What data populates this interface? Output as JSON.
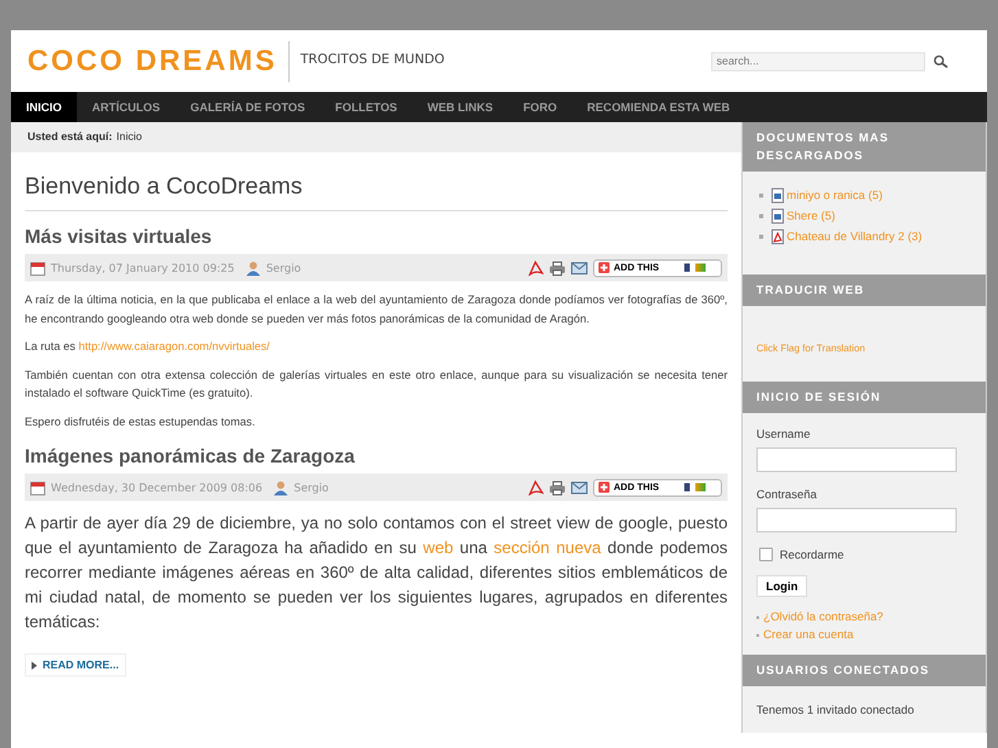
{
  "header": {
    "logo": "COCO DREAMS",
    "tagline": "TROCITOS DE MUNDO",
    "search": {
      "placeholder": "search..."
    }
  },
  "nav": [
    {
      "label": "INICIO",
      "selected": true
    },
    {
      "label": "ARTÍCULOS",
      "selected": false
    },
    {
      "label": "GALERÍA DE FOTOS",
      "selected": false
    },
    {
      "label": "FOLLETOS",
      "selected": false
    },
    {
      "label": "WEB LINKS",
      "selected": false
    },
    {
      "label": "FORO",
      "selected": false
    },
    {
      "label": "RECOMIENDA ESTA WEB",
      "selected": false
    }
  ],
  "breadcrumb": {
    "label": "Usted está aquí:",
    "current": "Inicio"
  },
  "page_title": "Bienvenido a CocoDreams",
  "articles": [
    {
      "title": "Más visitas virtuales",
      "date": "Thursday, 07 January 2010 09:25",
      "author": "Sergio",
      "share": "ADD THIS",
      "large": false,
      "paragraphs": [
        [
          {
            "kind": "text",
            "text": "A raíz de la última noticia, en la que publicaba el enlace a la web del ayuntamiento de Zaragoza donde podíamos ver fotografías de 360º, he encontrando googleando otra web donde se pueden ver más fotos panorámicas de la comunidad de Aragón."
          }
        ],
        [
          {
            "kind": "text",
            "text": "La ruta es "
          },
          {
            "kind": "link",
            "text": "http://www.caiaragon.com/nvvirtuales/"
          }
        ],
        [
          {
            "kind": "text",
            "text": "También cuentan con otra extensa colección de galerías virtuales en este otro enlace, aunque para su visualización se necesita tener instalado el software QuickTime (es gratuito)."
          }
        ],
        [
          {
            "kind": "text",
            "text": "Espero disfrutéis de estas estupendas tomas."
          }
        ]
      ]
    },
    {
      "title": "Imágenes panorámicas de Zaragoza",
      "date": "Wednesday, 30 December 2009 08:06",
      "author": "Sergio",
      "share": "ADD THIS",
      "large": true,
      "paragraphs": [
        [
          {
            "kind": "text",
            "text": "A partir de ayer día 29 de diciembre, ya no solo contamos con el street view de google, puesto que el ayuntamiento de Zaragoza ha añadido en su "
          },
          {
            "kind": "link",
            "text": "web"
          },
          {
            "kind": "text",
            "text": " una "
          },
          {
            "kind": "link",
            "text": "sección nueva"
          },
          {
            "kind": "text",
            "text": " donde podemos recorrer mediante imágenes aéreas en 360º de alta calidad, diferentes sitios emblemáticos de mi ciudad natal, de momento se pueden ver los siguientes lugares, agrupados en diferentes temáticas:"
          }
        ]
      ],
      "read_more": "READ MORE..."
    }
  ],
  "sidebar": {
    "downloads": {
      "title": "DOCUMENTOS MAS DESCARGADOS",
      "items": [
        {
          "label": "miniyo o ranica (5)",
          "kind": "image"
        },
        {
          "label": "Shere (5)",
          "kind": "image"
        },
        {
          "label": "Chateau de Villandry 2 (3)",
          "kind": "pdf"
        }
      ]
    },
    "translate": {
      "title": "TRADUCIR WEB",
      "link": "Click Flag for Translation"
    },
    "login": {
      "title": "INICIO DE SESIÓN",
      "username_label": "Username",
      "password_label": "Contraseña",
      "remember": {
        "label": "Recordarme",
        "checked": false
      },
      "button": "Login",
      "links": [
        "¿Olvidó la contraseña?",
        "Crear una cuenta"
      ]
    },
    "online": {
      "title": "USUARIOS CONECTADOS",
      "text": "Tenemos 1 invitado conectado"
    }
  }
}
